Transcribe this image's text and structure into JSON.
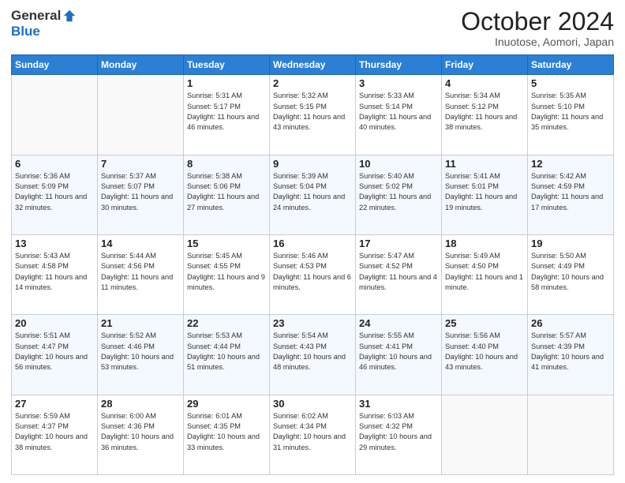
{
  "header": {
    "logo_general": "General",
    "logo_blue": "Blue",
    "month_title": "October 2024",
    "location": "Inuotose, Aomori, Japan"
  },
  "weekdays": [
    "Sunday",
    "Monday",
    "Tuesday",
    "Wednesday",
    "Thursday",
    "Friday",
    "Saturday"
  ],
  "weeks": [
    [
      {
        "day": "",
        "info": ""
      },
      {
        "day": "",
        "info": ""
      },
      {
        "day": "1",
        "info": "Sunrise: 5:31 AM\nSunset: 5:17 PM\nDaylight: 11 hours and 46 minutes."
      },
      {
        "day": "2",
        "info": "Sunrise: 5:32 AM\nSunset: 5:15 PM\nDaylight: 11 hours and 43 minutes."
      },
      {
        "day": "3",
        "info": "Sunrise: 5:33 AM\nSunset: 5:14 PM\nDaylight: 11 hours and 40 minutes."
      },
      {
        "day": "4",
        "info": "Sunrise: 5:34 AM\nSunset: 5:12 PM\nDaylight: 11 hours and 38 minutes."
      },
      {
        "day": "5",
        "info": "Sunrise: 5:35 AM\nSunset: 5:10 PM\nDaylight: 11 hours and 35 minutes."
      }
    ],
    [
      {
        "day": "6",
        "info": "Sunrise: 5:36 AM\nSunset: 5:09 PM\nDaylight: 11 hours and 32 minutes."
      },
      {
        "day": "7",
        "info": "Sunrise: 5:37 AM\nSunset: 5:07 PM\nDaylight: 11 hours and 30 minutes."
      },
      {
        "day": "8",
        "info": "Sunrise: 5:38 AM\nSunset: 5:06 PM\nDaylight: 11 hours and 27 minutes."
      },
      {
        "day": "9",
        "info": "Sunrise: 5:39 AM\nSunset: 5:04 PM\nDaylight: 11 hours and 24 minutes."
      },
      {
        "day": "10",
        "info": "Sunrise: 5:40 AM\nSunset: 5:02 PM\nDaylight: 11 hours and 22 minutes."
      },
      {
        "day": "11",
        "info": "Sunrise: 5:41 AM\nSunset: 5:01 PM\nDaylight: 11 hours and 19 minutes."
      },
      {
        "day": "12",
        "info": "Sunrise: 5:42 AM\nSunset: 4:59 PM\nDaylight: 11 hours and 17 minutes."
      }
    ],
    [
      {
        "day": "13",
        "info": "Sunrise: 5:43 AM\nSunset: 4:58 PM\nDaylight: 11 hours and 14 minutes."
      },
      {
        "day": "14",
        "info": "Sunrise: 5:44 AM\nSunset: 4:56 PM\nDaylight: 11 hours and 11 minutes."
      },
      {
        "day": "15",
        "info": "Sunrise: 5:45 AM\nSunset: 4:55 PM\nDaylight: 11 hours and 9 minutes."
      },
      {
        "day": "16",
        "info": "Sunrise: 5:46 AM\nSunset: 4:53 PM\nDaylight: 11 hours and 6 minutes."
      },
      {
        "day": "17",
        "info": "Sunrise: 5:47 AM\nSunset: 4:52 PM\nDaylight: 11 hours and 4 minutes."
      },
      {
        "day": "18",
        "info": "Sunrise: 5:49 AM\nSunset: 4:50 PM\nDaylight: 11 hours and 1 minute."
      },
      {
        "day": "19",
        "info": "Sunrise: 5:50 AM\nSunset: 4:49 PM\nDaylight: 10 hours and 58 minutes."
      }
    ],
    [
      {
        "day": "20",
        "info": "Sunrise: 5:51 AM\nSunset: 4:47 PM\nDaylight: 10 hours and 56 minutes."
      },
      {
        "day": "21",
        "info": "Sunrise: 5:52 AM\nSunset: 4:46 PM\nDaylight: 10 hours and 53 minutes."
      },
      {
        "day": "22",
        "info": "Sunrise: 5:53 AM\nSunset: 4:44 PM\nDaylight: 10 hours and 51 minutes."
      },
      {
        "day": "23",
        "info": "Sunrise: 5:54 AM\nSunset: 4:43 PM\nDaylight: 10 hours and 48 minutes."
      },
      {
        "day": "24",
        "info": "Sunrise: 5:55 AM\nSunset: 4:41 PM\nDaylight: 10 hours and 46 minutes."
      },
      {
        "day": "25",
        "info": "Sunrise: 5:56 AM\nSunset: 4:40 PM\nDaylight: 10 hours and 43 minutes."
      },
      {
        "day": "26",
        "info": "Sunrise: 5:57 AM\nSunset: 4:39 PM\nDaylight: 10 hours and 41 minutes."
      }
    ],
    [
      {
        "day": "27",
        "info": "Sunrise: 5:59 AM\nSunset: 4:37 PM\nDaylight: 10 hours and 38 minutes."
      },
      {
        "day": "28",
        "info": "Sunrise: 6:00 AM\nSunset: 4:36 PM\nDaylight: 10 hours and 36 minutes."
      },
      {
        "day": "29",
        "info": "Sunrise: 6:01 AM\nSunset: 4:35 PM\nDaylight: 10 hours and 33 minutes."
      },
      {
        "day": "30",
        "info": "Sunrise: 6:02 AM\nSunset: 4:34 PM\nDaylight: 10 hours and 31 minutes."
      },
      {
        "day": "31",
        "info": "Sunrise: 6:03 AM\nSunset: 4:32 PM\nDaylight: 10 hours and 29 minutes."
      },
      {
        "day": "",
        "info": ""
      },
      {
        "day": "",
        "info": ""
      }
    ]
  ]
}
